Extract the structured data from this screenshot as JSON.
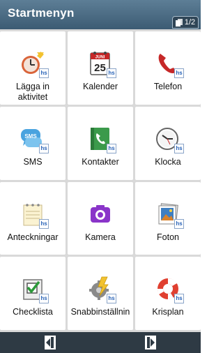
{
  "header": {
    "title": "Startmenyn",
    "page_indicator": "1/2"
  },
  "tiles": [
    {
      "label": "Lägga in aktivitet",
      "icon": "alarm-clock-icon"
    },
    {
      "label": "Kalender",
      "icon": "calendar-icon",
      "icon_text_month": "JUNI",
      "icon_text_day": "25"
    },
    {
      "label": "Telefon",
      "icon": "phone-handset-icon"
    },
    {
      "label": "SMS",
      "icon": "sms-bubble-icon",
      "icon_text": "SMS"
    },
    {
      "label": "Kontakter",
      "icon": "contact-book-icon"
    },
    {
      "label": "Klocka",
      "icon": "clock-icon"
    },
    {
      "label": "Anteckningar",
      "icon": "notepad-icon"
    },
    {
      "label": "Kamera",
      "icon": "camera-icon"
    },
    {
      "label": "Foton",
      "icon": "photos-icon"
    },
    {
      "label": "Checklista",
      "icon": "checklist-icon"
    },
    {
      "label": "Snabbinställnin",
      "icon": "quick-settings-icon"
    },
    {
      "label": "Krisplan",
      "icon": "lifebuoy-icon"
    }
  ],
  "badge_text": "hs",
  "footer": {
    "prev": "previous-page-icon",
    "next": "next-page-icon"
  },
  "colors": {
    "header": "#4b6b83",
    "footer": "#2e3a44",
    "grid_gap": "#d9d9d9",
    "camera": "#8a35c9",
    "phone": "#c62828"
  }
}
